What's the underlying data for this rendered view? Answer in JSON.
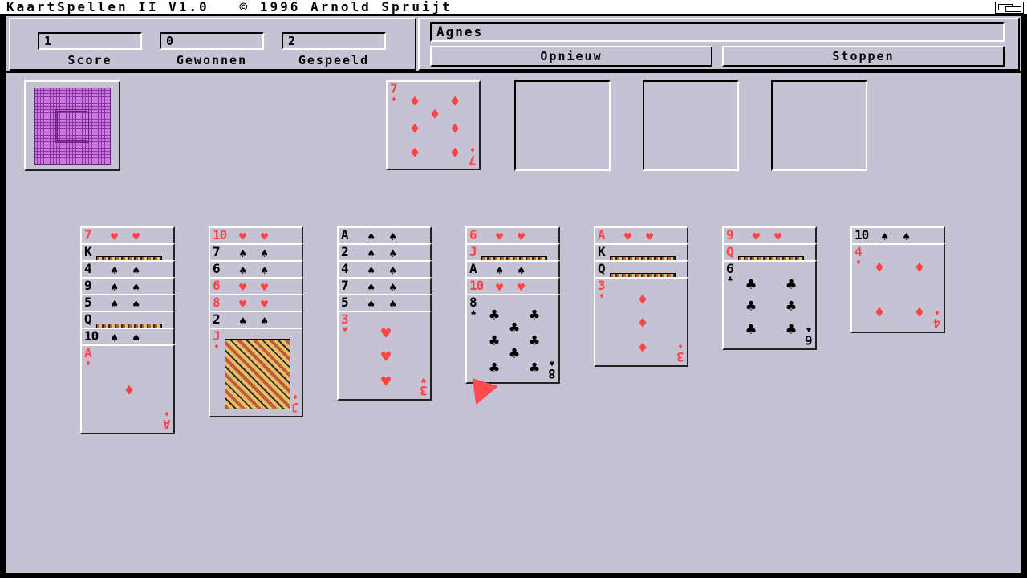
{
  "title_bar": {
    "text": "KaartSpellen II V1.0   © 1996 Arnold Spruijt"
  },
  "stats": {
    "score": {
      "value": "1",
      "label": "Score"
    },
    "won": {
      "value": "0",
      "label": "Gewonnen"
    },
    "played": {
      "value": "2",
      "label": "Gespeeld"
    }
  },
  "game_name": "Agnes",
  "buttons": {
    "restart": "Opnieuw",
    "stop": "Stoppen"
  },
  "colors": {
    "red_suit": "#ff4444",
    "black_suit": "#000000",
    "background": "#c4c2d3",
    "card_back": "#c77dd7"
  },
  "stock": {
    "face_down": true,
    "icon": "card-back-pattern"
  },
  "waste": {
    "rank": "7",
    "suit": "♦",
    "color": "red"
  },
  "foundations": [
    "",
    "",
    ""
  ],
  "tableau": [
    [
      {
        "rank": "7",
        "suit": "♥",
        "color": "red"
      },
      {
        "rank": "K",
        "suit": "♣",
        "color": "blk",
        "court": true
      },
      {
        "rank": "4",
        "suit": "♠",
        "color": "blk"
      },
      {
        "rank": "9",
        "suit": "♠",
        "color": "blk"
      },
      {
        "rank": "5",
        "suit": "♠",
        "color": "blk"
      },
      {
        "rank": "Q",
        "suit": "♣",
        "color": "blk",
        "court": true
      },
      {
        "rank": "10",
        "suit": "♠",
        "color": "blk"
      },
      {
        "rank": "A",
        "suit": "♦",
        "color": "red"
      }
    ],
    [
      {
        "rank": "10",
        "suit": "♥",
        "color": "red"
      },
      {
        "rank": "7",
        "suit": "♠",
        "color": "blk"
      },
      {
        "rank": "6",
        "suit": "♠",
        "color": "blk"
      },
      {
        "rank": "6",
        "suit": "♥",
        "color": "red"
      },
      {
        "rank": "8",
        "suit": "♥",
        "color": "red"
      },
      {
        "rank": "2",
        "suit": "♠",
        "color": "blk"
      },
      {
        "rank": "J",
        "suit": "♦",
        "color": "red",
        "court": true
      }
    ],
    [
      {
        "rank": "A",
        "suit": "♠",
        "color": "blk"
      },
      {
        "rank": "2",
        "suit": "♠",
        "color": "blk"
      },
      {
        "rank": "4",
        "suit": "♠",
        "color": "blk"
      },
      {
        "rank": "7",
        "suit": "♠",
        "color": "blk"
      },
      {
        "rank": "5",
        "suit": "♠",
        "color": "blk"
      },
      {
        "rank": "3",
        "suit": "♥",
        "color": "red"
      }
    ],
    [
      {
        "rank": "6",
        "suit": "♥",
        "color": "red"
      },
      {
        "rank": "J",
        "suit": "♥",
        "color": "red",
        "court": true
      },
      {
        "rank": "A",
        "suit": "♠",
        "color": "blk"
      },
      {
        "rank": "10",
        "suit": "♥",
        "color": "red"
      },
      {
        "rank": "8",
        "suit": "♣",
        "color": "blk"
      }
    ],
    [
      {
        "rank": "A",
        "suit": "♥",
        "color": "red"
      },
      {
        "rank": "K",
        "suit": "♦",
        "color": "blk",
        "court": true
      },
      {
        "rank": "Q",
        "suit": "♦",
        "color": "blk",
        "court": true
      },
      {
        "rank": "3",
        "suit": "♦",
        "color": "red"
      }
    ],
    [
      {
        "rank": "9",
        "suit": "♥",
        "color": "red"
      },
      {
        "rank": "Q",
        "suit": "♥",
        "color": "red",
        "court": true
      },
      {
        "rank": "6",
        "suit": "♣",
        "color": "blk"
      }
    ],
    [
      {
        "rank": "10",
        "suit": "♠",
        "color": "blk"
      },
      {
        "rank": "4",
        "suit": "♦",
        "color": "red"
      }
    ]
  ]
}
